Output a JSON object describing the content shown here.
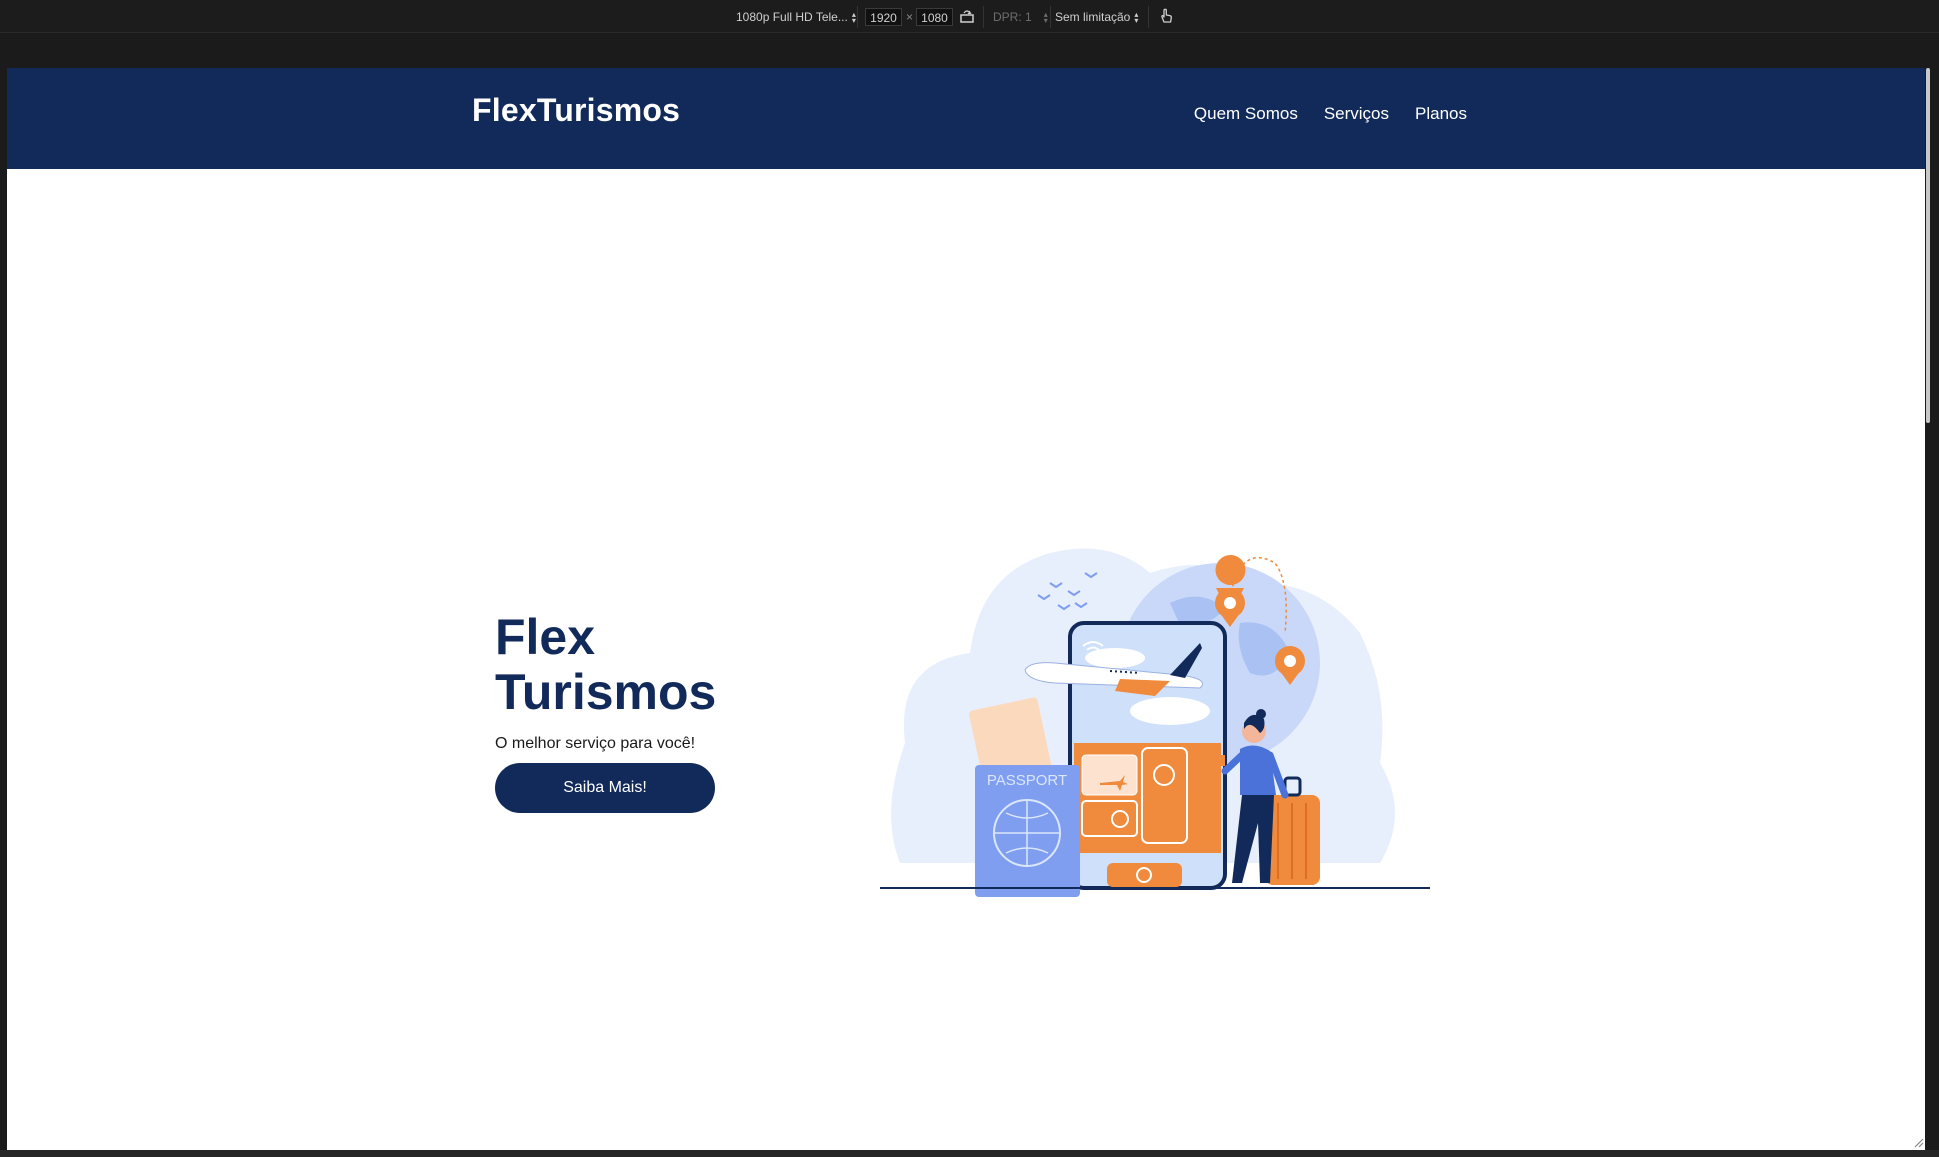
{
  "devtools": {
    "device": "1080p Full HD Tele...",
    "width": "1920",
    "times": "×",
    "height": "1080",
    "dpr": "DPR: 1",
    "throttle": "Sem limitação"
  },
  "site": {
    "brand": "FlexTurismos",
    "nav": [
      "Quem Somos",
      "Serviços",
      "Planos"
    ],
    "hero": {
      "title_line1": "Flex",
      "title_line2": "Turismos",
      "subtitle": "O melhor serviço para você!",
      "cta": "Saiba Mais!"
    },
    "illustration": {
      "passport_label": "PASSPORT"
    }
  },
  "colors": {
    "navy": "#122a5a",
    "orange": "#f08a3c",
    "light_blue": "#dbe6fb",
    "mid_blue": "#7f9ef0"
  }
}
